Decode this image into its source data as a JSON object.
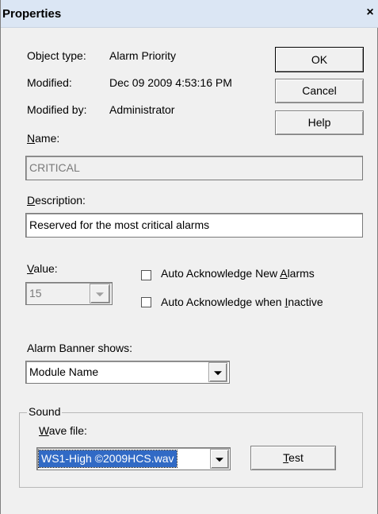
{
  "window": {
    "title": "Properties",
    "close_glyph": "×"
  },
  "info": {
    "object_type_label": "Object type:",
    "object_type_value": "Alarm Priority",
    "modified_label": "Modified:",
    "modified_value": "Dec 09 2009 4:53:16 PM",
    "modified_by_label": "Modified by:",
    "modified_by_value": "Administrator"
  },
  "buttons": {
    "ok": "OK",
    "cancel": "Cancel",
    "help": "Help",
    "test_prefix": "T",
    "test_rest": "est"
  },
  "name": {
    "label_prefix": "N",
    "label_rest": "ame:",
    "value": "CRITICAL"
  },
  "description": {
    "label_prefix": "D",
    "label_rest": "escription:",
    "value": "Reserved for the most critical alarms"
  },
  "value_field": {
    "label_prefix": "V",
    "label_rest": "alue:",
    "selected": "15"
  },
  "checkboxes": {
    "auto_ack_new_prefix": "Auto Acknowledge New ",
    "auto_ack_new_underlined": "A",
    "auto_ack_new_suffix": "larms",
    "auto_ack_new_checked": false,
    "auto_ack_inactive_prefix": "Auto Acknowledge when ",
    "auto_ack_inactive_underlined": "I",
    "auto_ack_inactive_suffix": "nactive",
    "auto_ack_inactive_checked": false
  },
  "banner": {
    "label": "Alarm Banner shows:",
    "selected": "Module Name"
  },
  "sound": {
    "group_label": "Sound",
    "wave_label_prefix": "W",
    "wave_label_rest": "ave file:",
    "wave_selected": "WS1-High ©2009HCS.wav"
  },
  "colors": {
    "titlebar": "#dbe6f4",
    "dialog_bg": "#f0f0f0",
    "selection": "#316ac5"
  }
}
